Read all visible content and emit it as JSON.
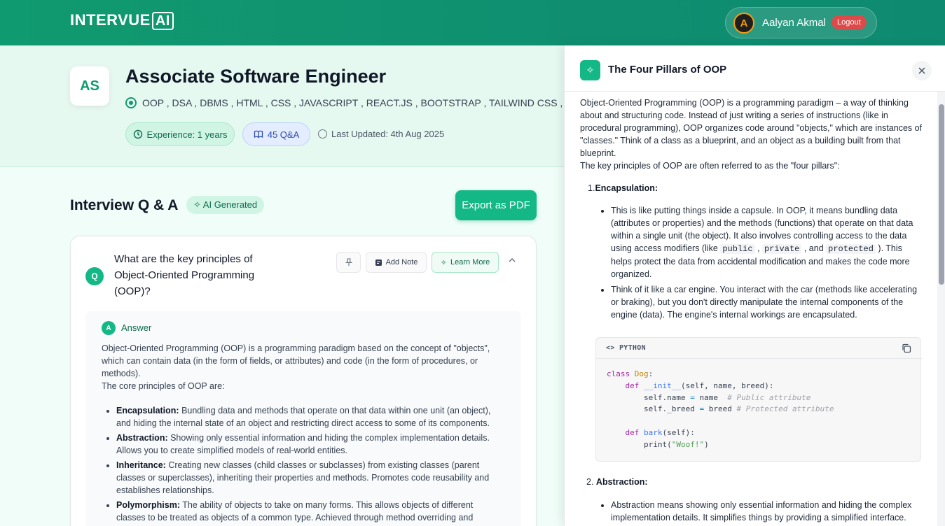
{
  "header": {
    "logo_main": "INTERVUE",
    "logo_ai": "AI",
    "user_initial": "A",
    "user_name": "Aalyan Akmal",
    "logout_label": "Logout"
  },
  "session": {
    "initials": "AS",
    "role": "Associate Software Engineer",
    "skills": "OOP , DSA , DBMS , HTML , CSS , JAVASCRIPT , REACT.JS , BOOTSTRAP , TAILWIND CSS , REACT",
    "experience": "Experience: 1 years",
    "qa_count": "45 Q&A",
    "last_updated": "Last Updated: 4th Aug 2025"
  },
  "qa_section": {
    "heading": "Interview Q & A",
    "ai_tag": "AI Generated",
    "export_label": "Export as PDF"
  },
  "question_card": {
    "q_badge": "Q",
    "question": "What are the key principles of Object-Oriented Programming (OOP)?",
    "add_note_label": "Add Note",
    "learn_more_label": "Learn More",
    "a_badge": "A",
    "answer_label": "Answer",
    "answer_intro": "Object-Oriented Programming (OOP) is a programming paradigm based on the concept of \"objects\", which can contain data (in the form of fields, or attributes) and code (in the form of procedures, or methods).",
    "answer_intro2": "The core principles of OOP are:",
    "principles": [
      {
        "name": "Encapsulation:",
        "desc": " Bundling data and methods that operate on that data within one unit (an object), and hiding the internal state of an object and restricting direct access to some of its components."
      },
      {
        "name": "Abstraction:",
        "desc": " Showing only essential information and hiding the complex implementation details. Allows you to create simplified models of real-world entities."
      },
      {
        "name": "Inheritance:",
        "desc": " Creating new classes (child classes or subclasses) from existing classes (parent classes or superclasses), inheriting their properties and methods. Promotes code reusability and establishes relationships."
      },
      {
        "name": "Polymorphism:",
        "desc": " The ability of objects to take on many forms. This allows objects of different classes to be treated as objects of a common type. Achieved through method overriding and interfaces."
      }
    ]
  },
  "panel": {
    "title": "The Four Pillars of OOP",
    "intro": "Object-Oriented Programming (OOP) is a programming paradigm – a way of thinking about and structuring code. Instead of just writing a series of instructions (like in procedural programming), OOP organizes code around \"objects,\" which are instances of \"classes.\" Think of a class as a blueprint, and an object as a building built from that blueprint.",
    "intro2": "The key principles of OOP are often referred to as the \"four pillars\":",
    "s1_num": "1.",
    "s1_title": "Encapsulation:",
    "s1_b1_a": "This is like putting things inside a capsule. In OOP, it means bundling data (attributes or properties) and the methods (functions) that operate on that data within a single unit (the object). It also involves controlling access to the data using access modifiers (like ",
    "s1_b1_code1": "public",
    "s1_b1_sep1": " , ",
    "s1_b1_code2": "private",
    "s1_b1_sep2": " , and ",
    "s1_b1_code3": "protected",
    "s1_b1_b": " ). This helps protect the data from accidental modification and makes the code more organized.",
    "s1_b2": "Think of it like a car engine. You interact with the car (methods like accelerating or braking), but you don't directly manipulate the internal components of the engine (data). The engine's internal workings are encapsulated.",
    "code_lang": "PYTHON",
    "s2_num": "2.",
    "s2_title": "Abstraction:",
    "s2_b1": "Abstraction means showing only essential information and hiding the complex implementation details. It simplifies things by providing a simplified interface. You"
  },
  "code": {
    "l1_kw": "class",
    "l1_cls": "Dog",
    "l1_end": ":",
    "l2_kw": "def",
    "l2_fn": "__init__",
    "l2_args": "(self, name, breed):",
    "l3_a": "self.name",
    "l3_op": "=",
    "l3_b": "name",
    "l3_cm": "# Public attribute",
    "l4_a": "self._breed",
    "l4_op": "=",
    "l4_b": "breed",
    "l4_cm": "# Protected attribute",
    "l6_kw": "def",
    "l6_fn": "bark",
    "l6_args": "(self):",
    "l7_fn": "print",
    "l7_open": "(",
    "l7_str": "\"Woof!\"",
    "l7_close": ")"
  },
  "colors": {
    "brand": "#109a6f",
    "accent": "#14b886",
    "logout": "#dc4a4a"
  }
}
